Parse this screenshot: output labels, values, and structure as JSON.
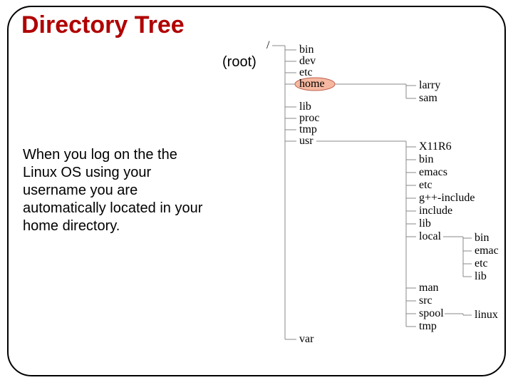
{
  "title": "Directory Tree",
  "root_annotation": "(root)",
  "body_text": "When you log on the the Linux OS using your username you are automatically located in your home directory.",
  "tree": {
    "root": "/",
    "highlighted": "home",
    "top_level": [
      "bin",
      "dev",
      "etc",
      "home",
      "lib",
      "proc",
      "tmp",
      "usr",
      "var"
    ],
    "home_children": [
      "larry",
      "sam"
    ],
    "usr_children": [
      "X11R6",
      "bin",
      "emacs",
      "etc",
      "g++-include",
      "include",
      "lib",
      "local",
      "man",
      "src",
      "spool",
      "tmp"
    ],
    "local_children": [
      "bin",
      "emacs",
      "etc",
      "lib"
    ],
    "spool_children": [
      "linux"
    ]
  }
}
